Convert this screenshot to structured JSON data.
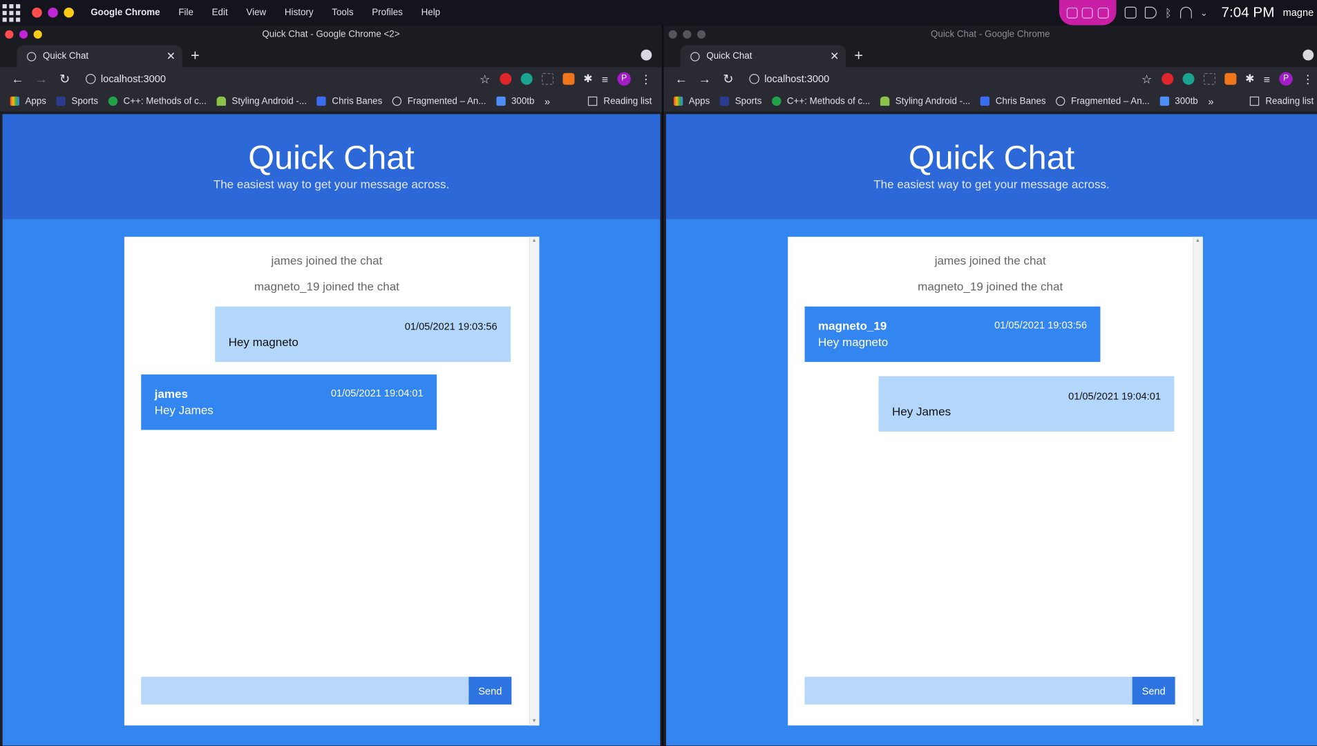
{
  "system_bar": {
    "app_name": "Google Chrome",
    "menus": [
      "File",
      "Edit",
      "View",
      "History",
      "Tools",
      "Profiles",
      "Help"
    ],
    "clock": "7:04 PM",
    "user": "magne"
  },
  "left_window": {
    "title": "Quick Chat - Google Chrome <2>",
    "tab_title": "Quick Chat",
    "url": "localhost:3000"
  },
  "right_window": {
    "title": "Quick Chat - Google Chrome",
    "tab_title": "Quick Chat",
    "url": "localhost:3000"
  },
  "bookmarks": [
    "Apps",
    "Sports",
    "C++: Methods of c...",
    "Styling Android -...",
    "Chris Banes",
    "Fragmented – An...",
    "300tb"
  ],
  "bookmarks_more": "»",
  "reading_list": "Reading list",
  "page": {
    "title": "Quick Chat",
    "subtitle": "The easiest way to get your message across.",
    "send_label": "Send"
  },
  "chat": {
    "system_messages": [
      "james joined the chat",
      "magneto_19 joined the chat"
    ],
    "left_view": [
      {
        "side": "mine",
        "name": "",
        "time": "01/05/2021 19:03:56",
        "text": "Hey magneto"
      },
      {
        "side": "theirs",
        "name": "james",
        "time": "01/05/2021 19:04:01",
        "text": "Hey James"
      }
    ],
    "right_view": [
      {
        "side": "theirs",
        "name": "magneto_19",
        "time": "01/05/2021 19:03:56",
        "text": "Hey magneto"
      },
      {
        "side": "mine",
        "name": "",
        "time": "01/05/2021 19:04:01",
        "text": "Hey James"
      }
    ]
  },
  "colors": {
    "header": "#2d68d8",
    "page_bg": "#3385f0",
    "own_bubble": "#b3d6fb",
    "other_bubble": "#3385f0"
  }
}
